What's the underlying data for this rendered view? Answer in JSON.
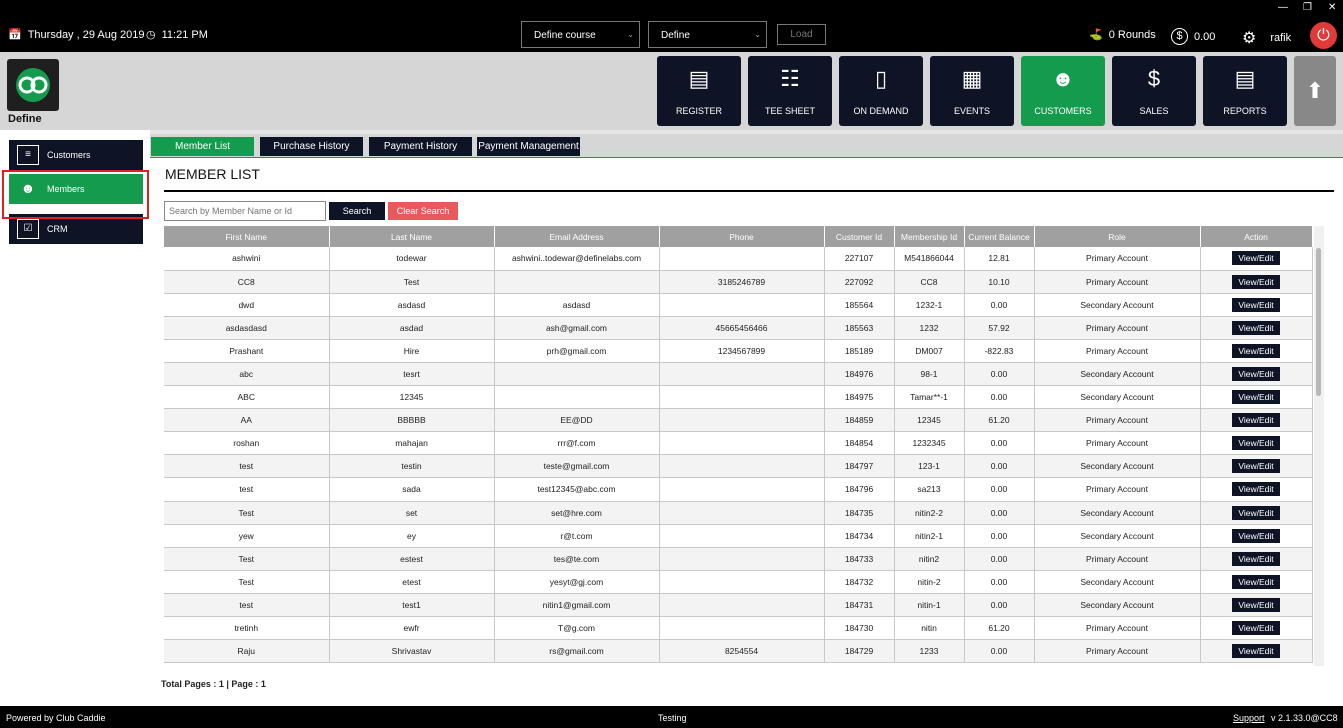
{
  "topbar": {
    "date": "Thursday ,  29 Aug 2019",
    "time": "11:21 PM",
    "course_select": "Define course",
    "define_select": "Define",
    "load_label": "Load",
    "rounds": "0 Rounds",
    "balance": "0.00",
    "user": "rafik"
  },
  "header": {
    "brand": "Define",
    "nav": [
      {
        "label": "REGISTER",
        "icon": "barcode-scanner-icon"
      },
      {
        "label": "TEE SHEET",
        "icon": "calendar-icon"
      },
      {
        "label": "ON DEMAND",
        "icon": "mobile-icon"
      },
      {
        "label": "EVENTS",
        "icon": "calendar-grid-icon"
      },
      {
        "label": "CUSTOMERS",
        "icon": "users-icon"
      },
      {
        "label": "SALES",
        "icon": "money-icon"
      },
      {
        "label": "REPORTS",
        "icon": "report-icon"
      }
    ]
  },
  "sidebar": {
    "items": [
      {
        "label": "Customers",
        "icon": "list-icon"
      },
      {
        "label": "Members",
        "icon": "users-icon"
      },
      {
        "label": "CRM",
        "icon": "checklist-icon"
      }
    ]
  },
  "tabs": [
    "Member List",
    "Purchase History",
    "Payment History",
    "Payment Management"
  ],
  "main": {
    "title": "MEMBER LIST",
    "search_placeholder": "Search by Member Name or Id",
    "search_label": "Search",
    "clear_label": "Clear Search",
    "columns": [
      "First Name",
      "Last Name",
      "Email Address",
      "Phone",
      "Customer Id",
      "Membership Id",
      "Current Balance",
      "Role",
      "Action"
    ],
    "action_label": "View/Edit",
    "rows": [
      [
        "ashwini",
        "todewar",
        "ashwini..todewar@definelabs.com",
        "",
        "227107",
        "M541866044",
        "12.81",
        "Primary Account"
      ],
      [
        "CC8",
        "Test",
        "",
        "3185246789",
        "227092",
        "CC8",
        "10.10",
        "Primary Account"
      ],
      [
        "dwd",
        "asdasd",
        "asdasd",
        "",
        "185564",
        "1232-1",
        "0.00",
        "Secondary Account"
      ],
      [
        "asdasdasd",
        "asdad",
        "ash@gmail.com",
        "45665456466",
        "185563",
        "1232",
        "57.92",
        "Primary Account"
      ],
      [
        "Prashant",
        "Hire",
        "prh@gmail.com",
        "1234567899",
        "185189",
        "DM007",
        "-822.83",
        "Primary Account"
      ],
      [
        "abc",
        "tesrt",
        "",
        "",
        "184976",
        "98-1",
        "0.00",
        "Secondary Account"
      ],
      [
        "ABC",
        "12345",
        "",
        "",
        "184975",
        "Tamar**-1",
        "0.00",
        "Secondary Account"
      ],
      [
        "AA",
        "BBBBB",
        "EE@DD",
        "",
        "184859",
        "12345",
        "61.20",
        "Primary Account"
      ],
      [
        "roshan",
        "mahajan",
        "rrr@f.com",
        "",
        "184854",
        "1232345",
        "0.00",
        "Primary Account"
      ],
      [
        "test",
        "testin",
        "teste@gmail.com",
        "",
        "184797",
        "123-1",
        "0.00",
        "Secondary Account"
      ],
      [
        "test",
        "sada",
        "test12345@abc.com",
        "",
        "184796",
        "sa213",
        "0.00",
        "Primary Account"
      ],
      [
        "Test",
        "set",
        "set@hre.com",
        "",
        "184735",
        "nitin2-2",
        "0.00",
        "Secondary Account"
      ],
      [
        "yew",
        "ey",
        "r@t.com",
        "",
        "184734",
        "nitin2-1",
        "0.00",
        "Secondary Account"
      ],
      [
        "Test",
        "estest",
        "tes@te.com",
        "",
        "184733",
        "nitin2",
        "0.00",
        "Primary Account"
      ],
      [
        "Test",
        "etest",
        "yesyt@gj.com",
        "",
        "184732",
        "nitin-2",
        "0.00",
        "Secondary Account"
      ],
      [
        "test",
        "test1",
        "nitin1@gmail.com",
        "",
        "184731",
        "nitin-1",
        "0.00",
        "Secondary Account"
      ],
      [
        "tretinh",
        "ewfr",
        "T@g.com",
        "",
        "184730",
        "nitin",
        "61.20",
        "Primary Account"
      ],
      [
        "Raju",
        "Shrivastav",
        "rs@gmail.com",
        "8254554",
        "184729",
        "1233",
        "0.00",
        "Primary Account"
      ]
    ],
    "pages": "Total Pages : 1 | Page : 1"
  },
  "footer": {
    "powered": "Powered by Club Caddie",
    "env": "Testing",
    "support": "Support",
    "version": "v 2.1.33.0@CC8"
  },
  "colors": {
    "accent": "#149b4e",
    "dark": "#0e1426",
    "danger": "#e8585c",
    "highlight": "#e02020"
  }
}
